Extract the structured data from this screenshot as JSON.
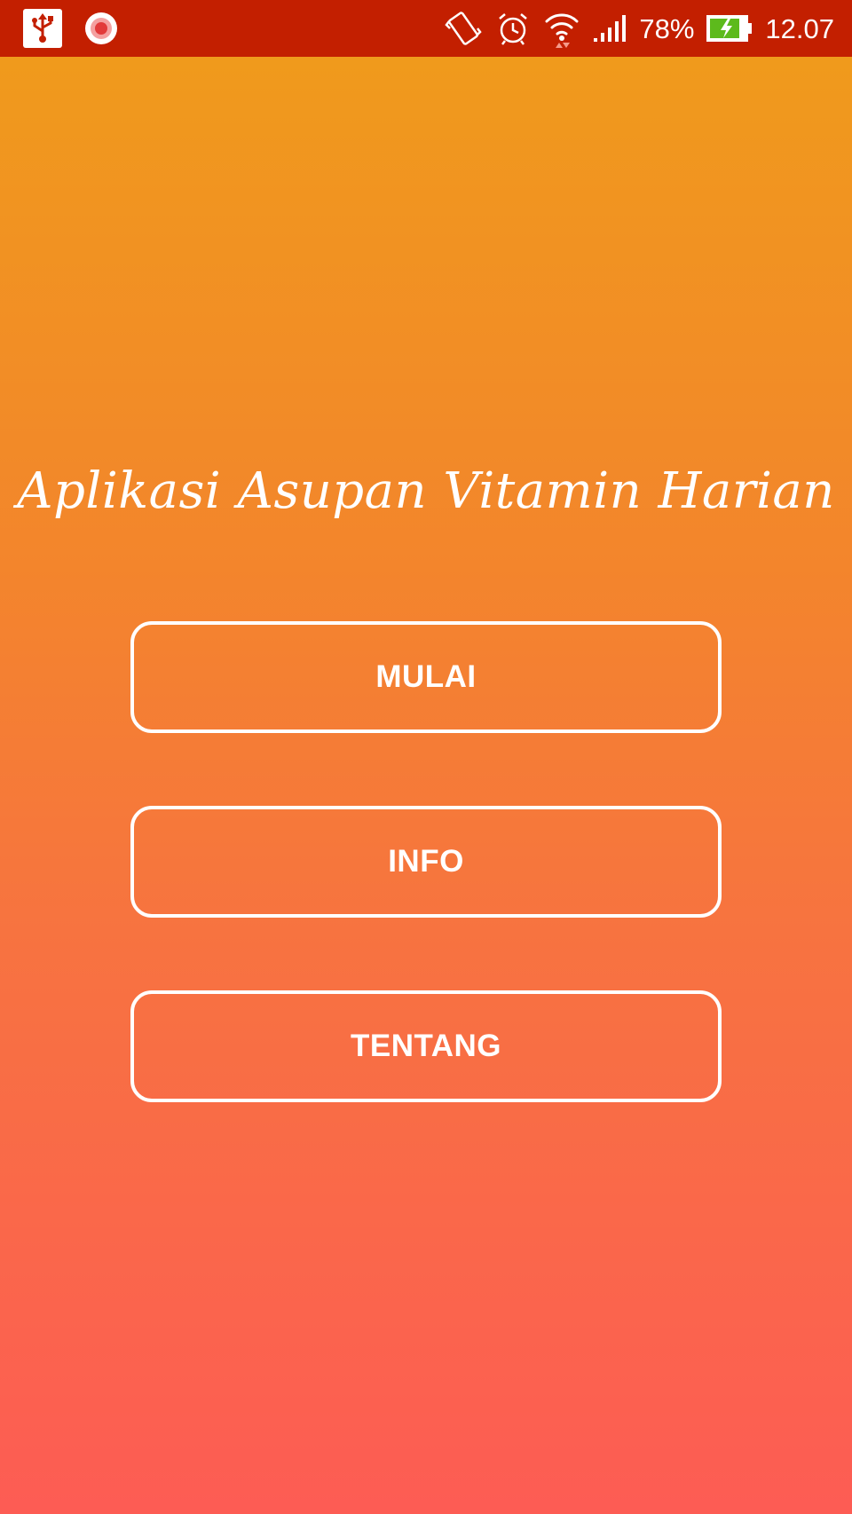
{
  "status_bar": {
    "battery_percent": "78%",
    "time": "12.07",
    "icons": [
      "usb-icon",
      "screen-record-icon",
      "vibrate-icon",
      "alarm-icon",
      "wifi-icon",
      "signal-icon",
      "battery-charging-icon"
    ],
    "background_color": "#c31f00"
  },
  "main": {
    "title": "Aplikasi Asupan Vitamin Harian",
    "buttons": [
      {
        "label": "MULAI"
      },
      {
        "label": "INFO"
      },
      {
        "label": "TENTANG"
      }
    ],
    "gradient_colors": [
      "#f09a1c",
      "#f3852c",
      "#f77340",
      "#fd5c54"
    ]
  }
}
